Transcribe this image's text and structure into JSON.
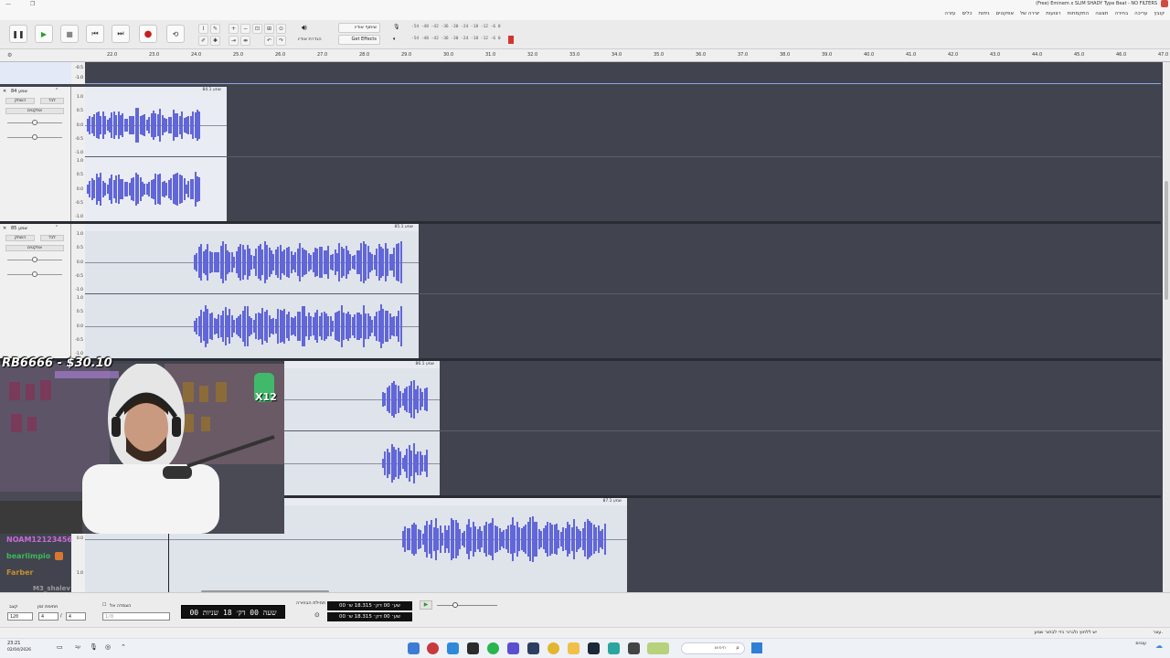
{
  "window": {
    "title": "(Free) Eminem x SLIM SHADY Type Beat - NO FILTERS"
  },
  "menu": [
    "קובץ",
    "עריכה",
    "בחירה",
    "תצוגה",
    "התקמחות",
    "רצועות",
    "יצירה של",
    "אפקטים",
    "ניתוח",
    "כלים",
    "עזרה"
  ],
  "toolbar": {
    "share_label": "שיתוף אודיו",
    "get_effects_label": "Get Effects",
    "audio_setup_label": "הגדרת אודיו",
    "meter_scale": "-54 -48 -42 -36 -30 -24 -18 -12 -6 0",
    "meter_scale_b": "-54 -48 -42 -36 -30 -24 -18 -12 -6 0"
  },
  "ruler": {
    "ticks": [
      "22.0",
      "23.0",
      "24.0",
      "25.0",
      "26.0",
      "27.0",
      "28.0",
      "29.0",
      "30.0",
      "31.0",
      "32.0",
      "33.0",
      "34.0",
      "35.0",
      "36.0",
      "37.0",
      "38.0",
      "39.0",
      "40.0",
      "41.0",
      "42.0",
      "43.0",
      "44.0",
      "45.0",
      "46.0",
      "47.0"
    ]
  },
  "tracks": [
    {
      "name": "שמע 84",
      "clip_label": "84.1 שמע",
      "mute": "השתק",
      "solo": "לבד",
      "effects": "אפקטים"
    },
    {
      "name": "שמע 85",
      "clip_label": "85.1 שמע",
      "mute": "השתק",
      "solo": "לבד",
      "effects": "אפקטים"
    },
    {
      "name": "",
      "clip_label": "86.1 שמע",
      "mute": "",
      "solo": "",
      "effects": ""
    },
    {
      "name": "",
      "clip_label": "87.1 שמע",
      "mute": "",
      "solo": "",
      "effects": ""
    }
  ],
  "scale_labels": {
    "top": "1.0",
    "upper": "0.5",
    "mid": "0.0",
    "lower": "-0.5",
    "bottom": "-1.0"
  },
  "overlay": {
    "donation": "RB6666 - $30.10",
    "badge": "X12",
    "chat": [
      {
        "user": "NOAM12123456",
        "color": "#c86bd8"
      },
      {
        "user": "bearlimpio",
        "color": "#3cb95a"
      },
      {
        "user": "Farber",
        "color": "#c98f2b"
      },
      {
        "user": "M3_shalev",
        "color": "#9a9a9a"
      }
    ]
  },
  "bottom": {
    "tempo_label": "קצב",
    "tempo_value": "120",
    "timesig_label": "חתימת זמן",
    "timesig_num": "4",
    "timesig_den": "4",
    "snap_label": "הצמדה אל",
    "snap_value": "1/8",
    "main_time": "00 שעה 00 דק׳ 18 שניות",
    "selection_label": "תחילת הבחירה",
    "sel_start": "00 שע׳ 00 דק׳ 18.315 ש׳",
    "sel_end": "00 שע׳ 00 דק׳ 18.315 ש׳"
  },
  "status": {
    "text": "יש ללחוץ ולגרור כדי לבחור שמע",
    "right_text": "עצר."
  },
  "taskbar": {
    "time": "23:21",
    "date": "02/04/2026",
    "search": "חיפוש",
    "weather": "עננים"
  }
}
